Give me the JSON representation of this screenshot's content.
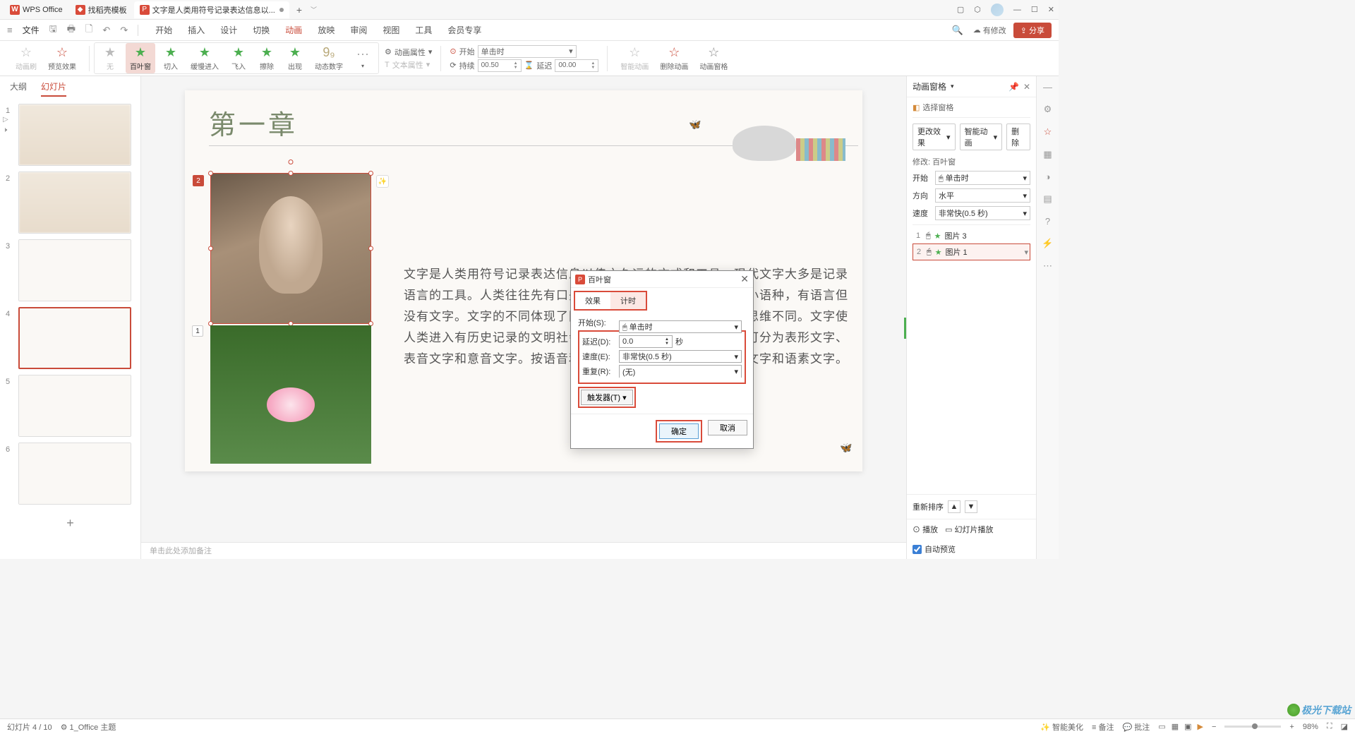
{
  "titlebar": {
    "app_tab": "WPS Office",
    "template_tab": "找稻壳模板",
    "doc_tab": "文字是人类用符号记录表达信息以...",
    "plus": "+"
  },
  "quickbar": {
    "file": "文件",
    "menu": {
      "start": "开始",
      "insert": "插入",
      "design": "设计",
      "transition": "切换",
      "animation": "动画",
      "slideshow": "放映",
      "review": "审阅",
      "view": "视图",
      "tools": "工具",
      "member": "会员专享"
    },
    "has_change": "有修改",
    "share": "分享"
  },
  "ribbon": {
    "brush": "动画刷",
    "preview": "预览效果",
    "none": "无",
    "blinds": "百叶窗",
    "cut": "切入",
    "slow": "缓慢进入",
    "fly": "飞入",
    "wipe": "擦除",
    "appear": "出现",
    "dynum": "动态数字",
    "anim_attr": "动画属性",
    "text_attr": "文本属性",
    "start_lbl": "开始",
    "start_val": "单击时",
    "duration_lbl": "持续",
    "duration_val": "00.50",
    "delay_lbl": "延迟",
    "delay_val": "00.00",
    "smart": "智能动画",
    "delete": "删除动画",
    "pane": "动画窗格"
  },
  "sidetabs": {
    "outline": "大纲",
    "slides": "幻灯片"
  },
  "slide": {
    "title": "第一章",
    "body": "文字是人类用符号记录表达信息以传之久远的方式和工具。现代文字大多是记录语言的工具。人类往往先有口头的语言后产生书面文字，很多小语种，有语言但没有文字。文字的不同体现了国家和民族的书面表达的方式和思维不同。文字使人类进入有历史记录的文明社会。赵依依文字按字音和字形，可分为表形文字、表音文字和意音文字。按语音和语素，可分为音素文字、音节文字和语素文字。",
    "badge1": "2",
    "badge2": "1"
  },
  "notes": "单击此处添加备注",
  "dialog": {
    "title": "百叶窗",
    "tab_effect": "效果",
    "tab_timing": "计时",
    "start_lbl": "开始(S):",
    "start_val": "单击时",
    "delay_lbl": "延迟(D):",
    "delay_val": "0.0",
    "delay_unit": "秒",
    "speed_lbl": "速度(E):",
    "speed_val": "非常快(0.5 秒)",
    "repeat_lbl": "重复(R):",
    "repeat_val": "(无)",
    "trigger": "触发器(T)",
    "ok": "确定",
    "cancel": "取消"
  },
  "panel": {
    "title": "动画窗格",
    "select_pane": "选择窗格",
    "change_effect": "更改效果",
    "smart_anim": "智能动画",
    "delete": "删除",
    "modify_lbl": "修改: 百叶窗",
    "start_lbl": "开始",
    "start_val": "单击时",
    "dir_lbl": "方向",
    "dir_val": "水平",
    "speed_lbl": "速度",
    "speed_val": "非常快(0.5 秒)",
    "item1_ord": "1",
    "item1_name": "图片 3",
    "item2_ord": "2",
    "item2_name": "图片 1",
    "reorder": "重新排序",
    "play": "播放",
    "slideshow_play": "幻灯片播放",
    "auto_preview": "自动预览"
  },
  "statusbar": {
    "slide_pos": "幻灯片 4 / 10",
    "theme": "1_Office 主题",
    "smart_beauty": "智能美化",
    "notes": "备注",
    "comments": "批注",
    "zoom": "98%"
  },
  "watermark": "极光下载站"
}
